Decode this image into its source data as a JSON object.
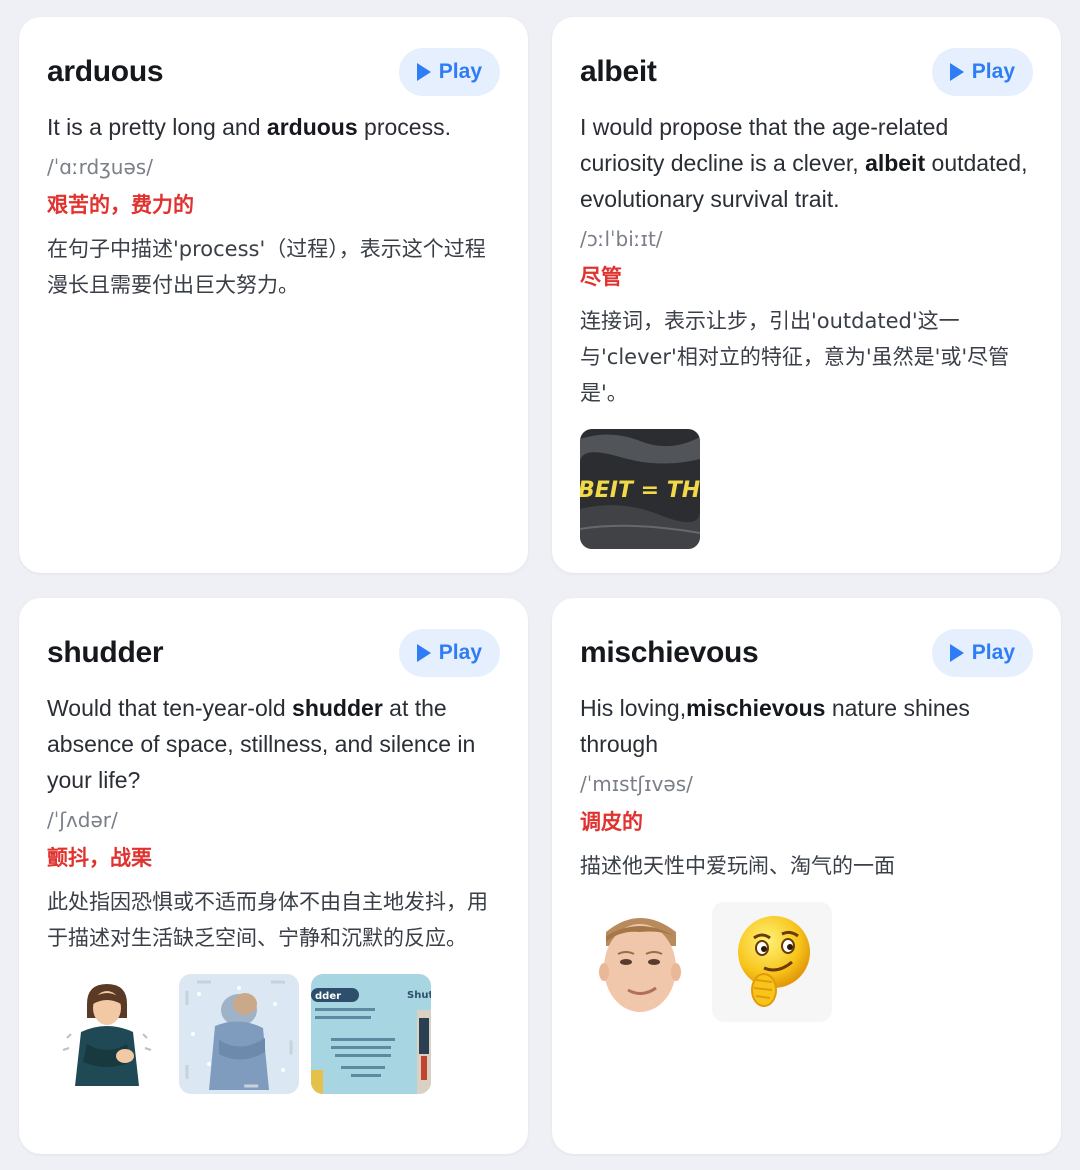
{
  "cards": [
    {
      "word": "arduous",
      "play_label": "Play",
      "sentence_before": "It is a pretty long and ",
      "sentence_bold": "arduous",
      "sentence_after": " process.",
      "phonetic": "/ˈɑːrdʒuəs/",
      "meaning": "艰苦的，费力的",
      "explanation": "在句子中描述'process'（过程），表示这个过程漫长且需要付出巨大努力。"
    },
    {
      "word": "albeit",
      "play_label": "Play",
      "sentence_before": "I would propose that the age-related curiosity decline is a clever, ",
      "sentence_bold": "albeit",
      "sentence_after": " outdated, evolutionary survival trait.",
      "phonetic": "/ɔːlˈbiːɪt/",
      "meaning": "尽管",
      "explanation": "连接词，表示让步，引出'outdated'这一与'clever'相对立的特征，意为'虽然是'或'尽管是'。",
      "image_texts": [
        "BEIT = THOU"
      ]
    },
    {
      "word": "shudder",
      "play_label": "Play",
      "sentence_before": "Would that ten-year-old ",
      "sentence_bold": "shudder",
      "sentence_after": " at the absence of space, stillness, and silence in your life?",
      "phonetic": "/ˈʃʌdər/",
      "meaning": "颤抖，战栗",
      "explanation": "此处指因恐惧或不适而身体不由自主地发抖，用于描述对生活缺乏空间、宁静和沉默的反应。",
      "image_texts": [
        "dder",
        "Shut"
      ]
    },
    {
      "word": "mischievous",
      "play_label": "Play",
      "sentence_before": "His loving,",
      "sentence_bold": "mischievous",
      "sentence_after": " nature shines through",
      "phonetic": "/ˈmɪstʃɪvəs/",
      "meaning": "调皮的",
      "explanation": "描述他天性中爱玩闹、淘气的一面"
    }
  ],
  "colors": {
    "background": "#eef0f5",
    "card": "#ffffff",
    "accent_blue": "#2f7df6",
    "play_bg": "#e6effd",
    "meaning_red": "#e0322e"
  },
  "icons": {
    "play": "play-icon"
  }
}
